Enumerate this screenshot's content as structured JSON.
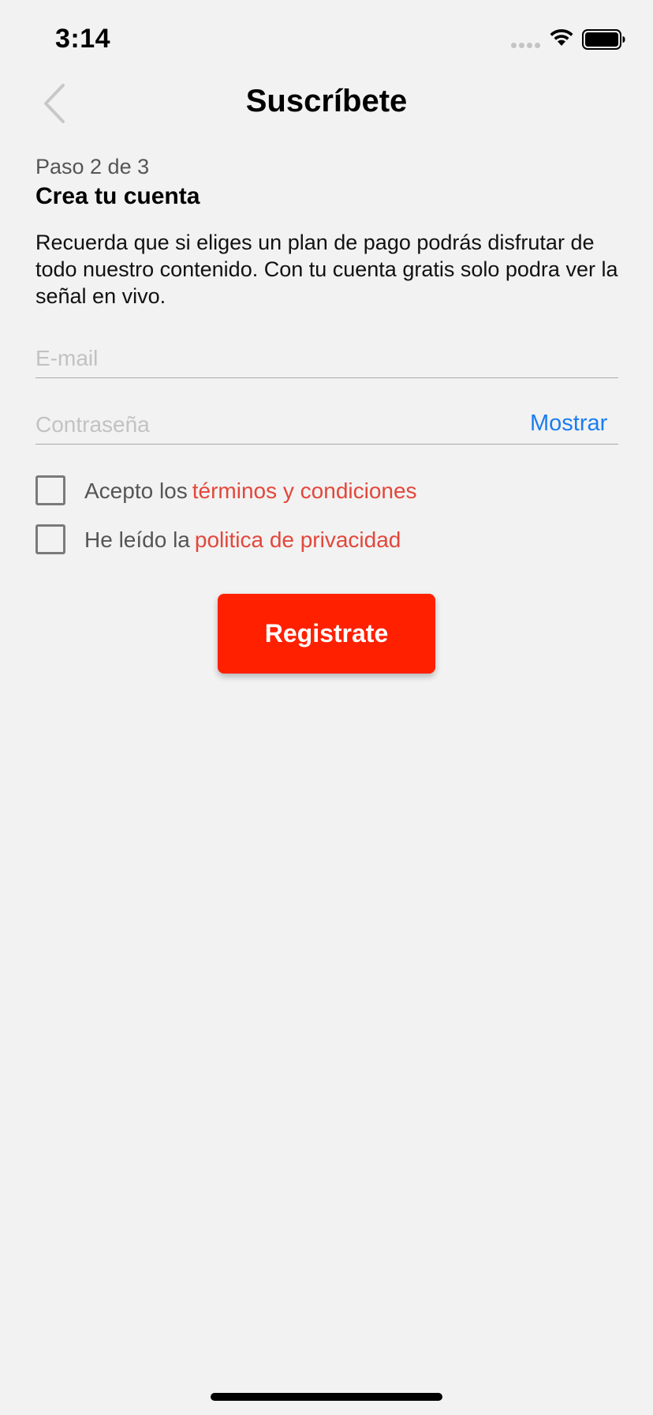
{
  "status_bar": {
    "time": "3:14"
  },
  "nav": {
    "title": "Suscríbete"
  },
  "step": {
    "label": "Paso 2 de 3",
    "title": "Crea tu cuenta",
    "description": "Recuerda que si eliges un plan de pago podrás disfrutar de todo nuestro contenido. Con tu cuenta gratis solo podra ver la señal en vivo."
  },
  "form": {
    "email": {
      "value": "",
      "placeholder": "E-mail"
    },
    "password": {
      "value": "",
      "placeholder": "Contraseña",
      "show_label": "Mostrar"
    },
    "terms": {
      "prefix": "Acepto los",
      "link": "términos y condiciones",
      "checked": false
    },
    "privacy": {
      "prefix": "He leído la",
      "link": "politica de privacidad",
      "checked": false
    },
    "submit_label": "Registrate"
  },
  "colors": {
    "background": "#f2f2f2",
    "primary_button": "#ff2000",
    "link_red": "#e2473b",
    "link_blue": "#1a7df0"
  },
  "icons": [
    "back-chevron-icon",
    "signal-icon",
    "wifi-icon",
    "battery-icon"
  ]
}
